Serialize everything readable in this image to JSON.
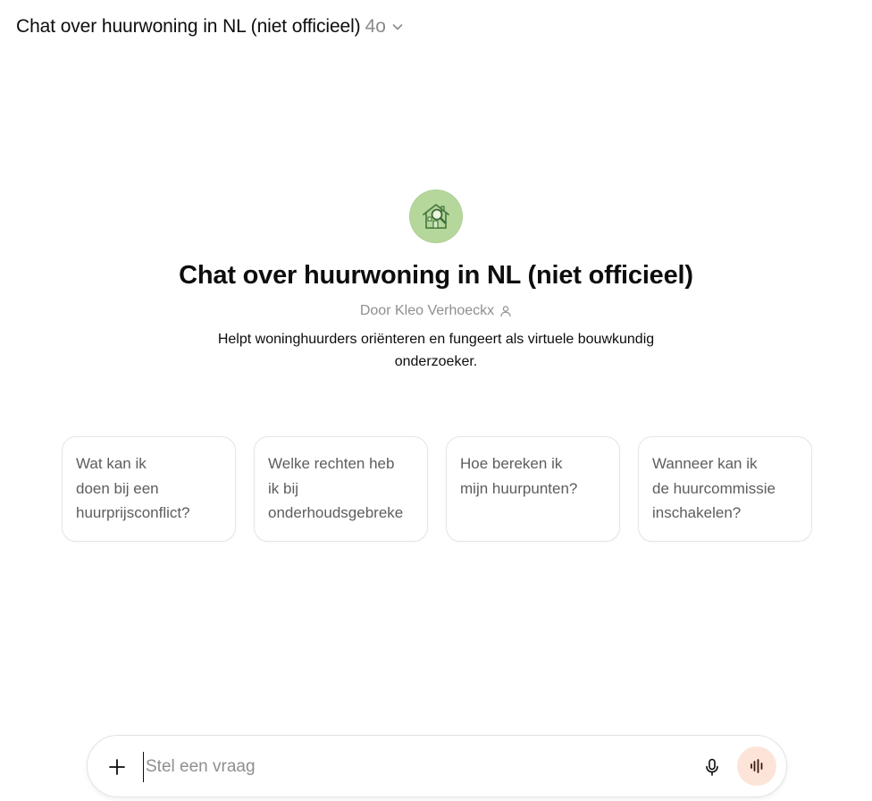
{
  "header": {
    "title": "Chat over huurwoning in NL (niet officieel)",
    "model": "4o"
  },
  "hero": {
    "avatar_icon": "house-magnifier-icon",
    "title": "Chat over huurwoning in NL (niet officieel)",
    "author": "Door Kleo Verhoeckx",
    "description": "Helpt woninghuurders oriënteren en fungeert als virtuele bouwkundig onderzoeker."
  },
  "suggestions": [
    {
      "label": "Wat kan ik\ndoen bij een\nhuurprijsconflict?"
    },
    {
      "label": "Welke rechten heb\nik bij\nonderhoudsgebreke"
    },
    {
      "label": "Hoe bereken ik\nmijn huurpunten?"
    },
    {
      "label": "Wanneer kan ik\nde huurcommissie\ninschakelen?"
    }
  ],
  "composer": {
    "placeholder": "Stel een vraag",
    "value": ""
  },
  "colors": {
    "avatar_bg": "#b5d79c",
    "voice_button_bg": "#fde4d8",
    "muted_text": "#8f8f8f",
    "card_text": "#5d5d5d"
  }
}
